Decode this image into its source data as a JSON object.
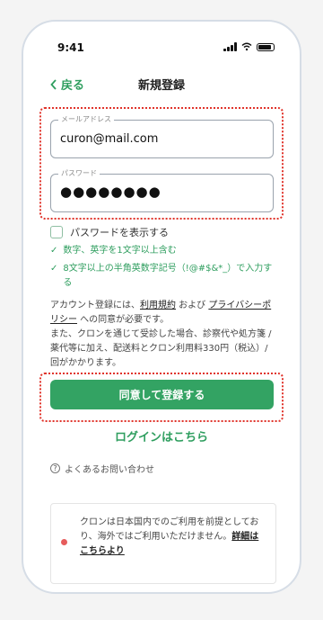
{
  "status": {
    "time": "9:41"
  },
  "nav": {
    "back_label": "戻る",
    "title": "新規登録"
  },
  "email": {
    "label": "メールアドレス",
    "value": "curon@mail.com"
  },
  "password": {
    "label": "パスワード",
    "value": "●●●●●●●●"
  },
  "show_password": {
    "label": "パスワードを表示する",
    "checked": false
  },
  "rules": [
    "数字、英字を1文字以上含む",
    "8文字以上の半角英数字記号（!@#$&*_）で入力する"
  ],
  "terms": {
    "prefix": "アカウント登録には、",
    "link1": "利用規約",
    "mid": " および ",
    "link2": "プライバシーポリシー",
    "suffix": " への同意が必要です。",
    "line2": "また、クロンを通じて受診した場合、診察代や処方箋 / 薬代等に加え、配送料とクロン利用料330円（税込）/ 回がかかります。"
  },
  "submit": {
    "label": "同意して登録する"
  },
  "login_link": {
    "label": "ログインはこちら"
  },
  "faq": {
    "label": "よくあるお問い合わせ"
  },
  "notice": {
    "text": "クロンは日本国内でのご利用を前提としており、海外ではご利用いただけません。",
    "link": "詳細はこちらより"
  },
  "colors": {
    "accent": "#33a363",
    "highlight": "#e0342b"
  }
}
